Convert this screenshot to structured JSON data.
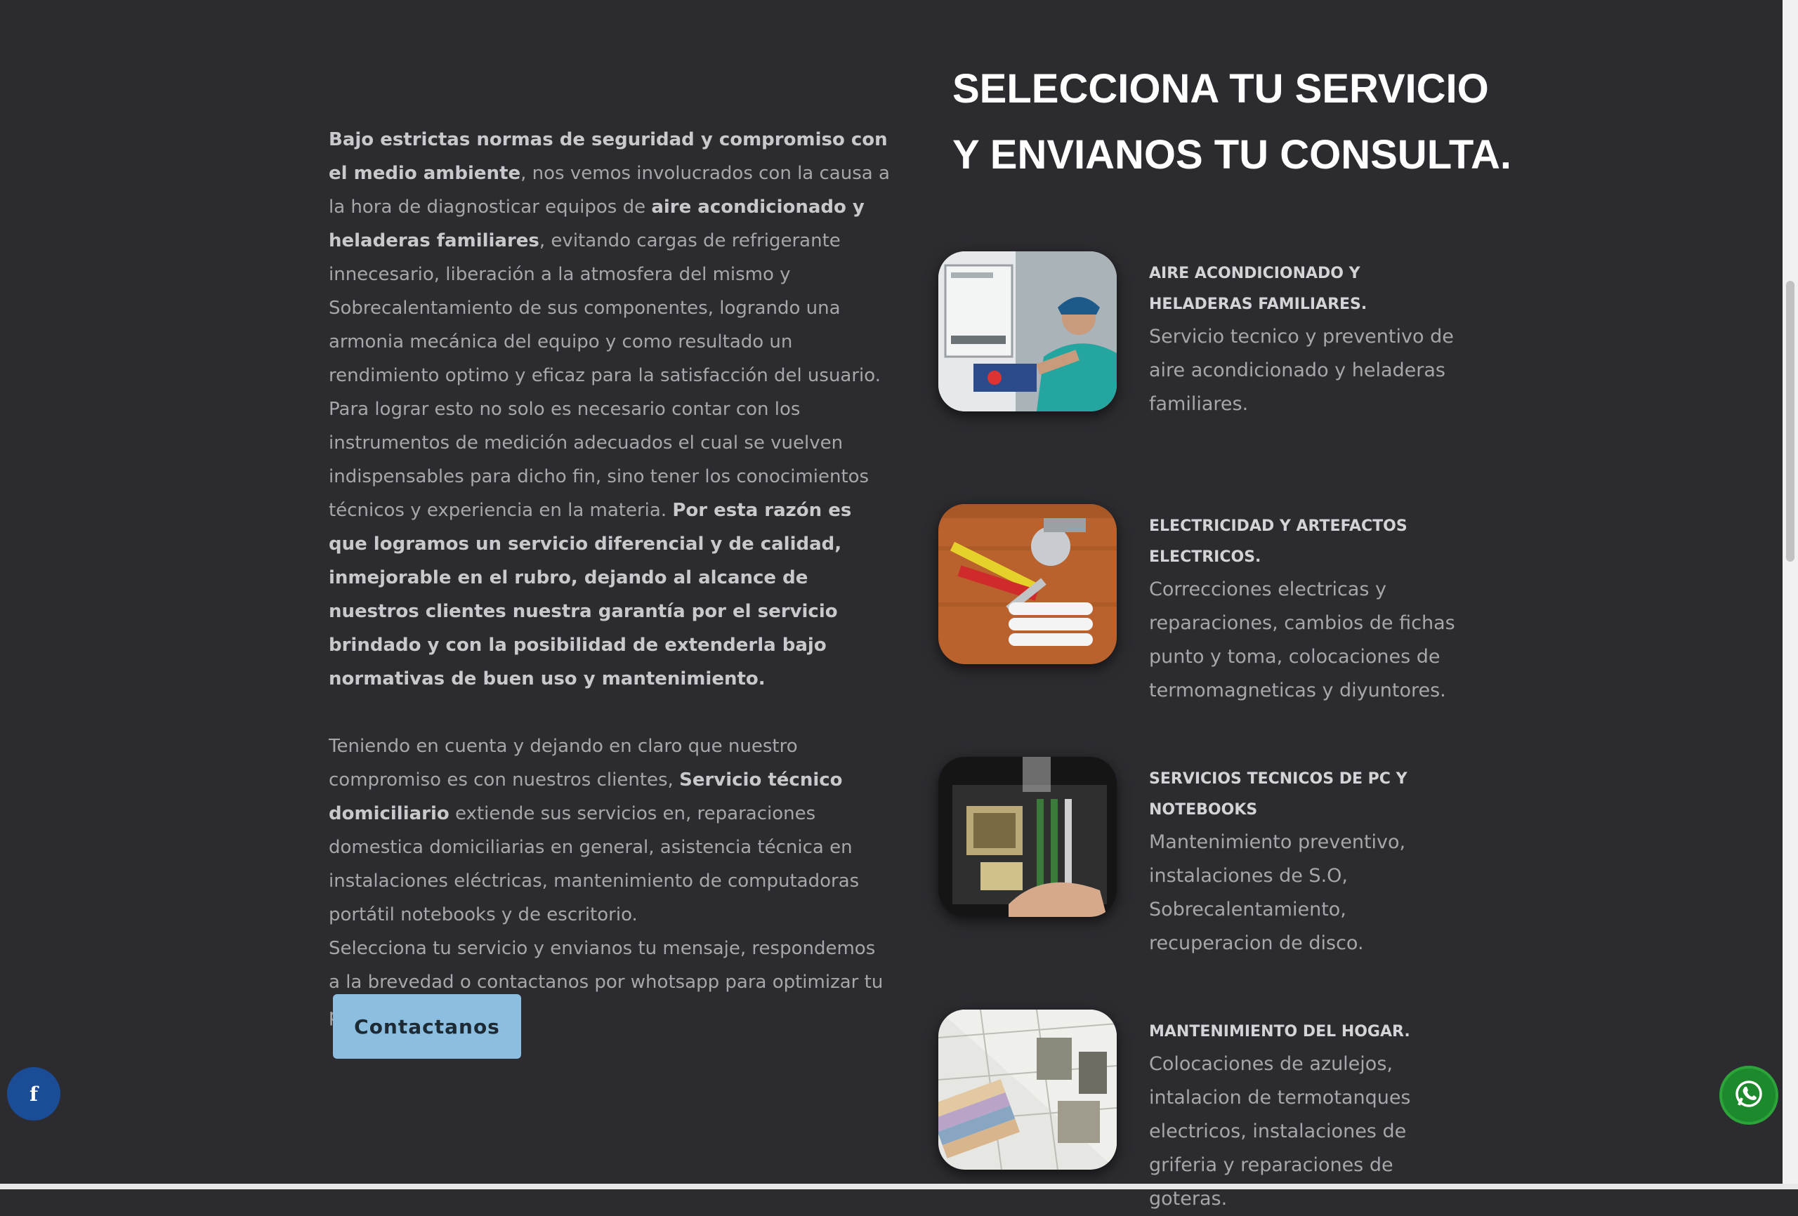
{
  "left": {
    "p1": [
      {
        "t": "Bajo estrictas normas de seguridad y compromiso con el medio ambiente",
        "b": true
      },
      {
        "t": ", nos vemos involucrados con la causa a la hora de diagnosticar equipos de ",
        "b": false
      },
      {
        "t": "aire acondicionado y heladeras familiares",
        "b": true
      },
      {
        "t": ", evitando cargas de refrigerante innecesario, liberación a la atmosfera del mismo y Sobrecalentamiento de sus componentes, logrando una armonia mecánica del equipo y como resultado un rendimiento optimo y eficaz para la satisfacción del usuario. Para lograr esto no solo es necesario contar con los instrumentos de medición adecuados el cual se vuelven indispensables para dicho fin, sino tener los conocimientos técnicos y experiencia en la materia. ",
        "b": false
      },
      {
        "t": "Por esta razón es que logramos un servicio diferencial y de calidad, inmejorable en el rubro, dejando al alcance de nuestros clientes nuestra garantía por el servicio brindado y con la posibilidad de extenderla bajo normativas de buen uso y mantenimiento.",
        "b": true
      }
    ],
    "p2": [
      {
        "t": "Teniendo en cuenta y dejando en claro que nuestro compromiso es con nuestros clientes, ",
        "b": false
      },
      {
        "t": "Servicio técnico domiciliario",
        "b": true
      },
      {
        "t": " extiende sus servicios en, reparaciones domestica domiciliarias en general, asistencia técnica en instalaciones eléctricas, mantenimiento de computadoras portátil notebooks y de escritorio.",
        "b": false
      }
    ],
    "p3": "Selecciona tu servicio y envianos tu mensaje, respondemos a la brevedad o contactanos por whotsapp para optimizar tu pedido.",
    "cta_label": "Contactanos"
  },
  "heading": "SELECCIONA TU SERVICIO Y ENVIANOS TU CONSULTA.",
  "services": [
    {
      "title": "AIRE ACONDICIONADO Y HELADERAS FAMILIARES.",
      "desc": "Servicio tecnico y preventivo de aire acondicionado y heladeras familiares."
    },
    {
      "title": "ELECTRICIDAD Y ARTEFACTOS ELECTRICOS.",
      "desc": "Correcciones electricas y reparaciones, cambios de fichas punto y toma, colocaciones de termomagneticas y diyuntores."
    },
    {
      "title": "SERVICIOS TECNICOS DE PC Y NOTEBOOKS",
      "desc": "Mantenimiento preventivo, instalaciones de S.O, Sobrecalentamiento, recuperacion de disco."
    },
    {
      "title": "MANTENIMIENTO DEL HOGAR.",
      "desc": "Colocaciones de azulejos, intalacion de termotanques electricos, instalaciones de griferia y reparaciones de goteras."
    }
  ],
  "floating": {
    "facebook_label": "f",
    "whatsapp_icon": "whatsapp-icon"
  },
  "colors": {
    "background": "#2c2b30",
    "cta": "#8bbedf",
    "whatsapp": "#1c8a2c",
    "facebook": "#1a4d96"
  }
}
